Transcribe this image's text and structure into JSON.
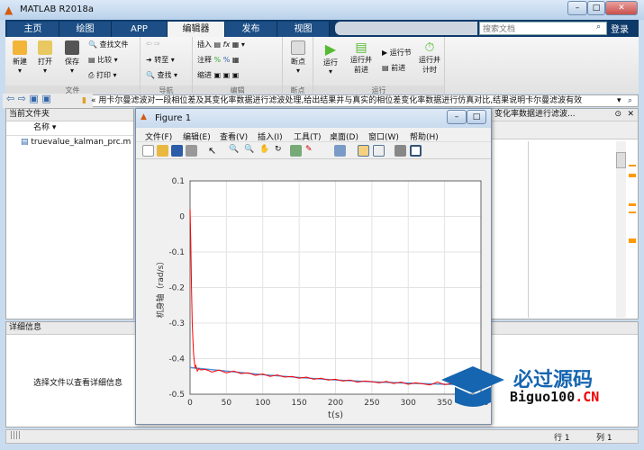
{
  "window": {
    "title": "MATLAB R2018a"
  },
  "tabs": [
    {
      "label": "主页"
    },
    {
      "label": "绘图"
    },
    {
      "label": "APP"
    },
    {
      "label": "编辑器"
    },
    {
      "label": "发布"
    },
    {
      "label": "视图"
    }
  ],
  "search": {
    "placeholder": "搜索文档"
  },
  "login": "登录",
  "ribbon": {
    "file": {
      "label": "文件",
      "new": "新建",
      "open": "打开",
      "save": "保存",
      "find_files": "查找文件",
      "compare": "比较",
      "print": "打印"
    },
    "nav": {
      "label": "导航",
      "goto": "转至",
      "find": "查找"
    },
    "edit": {
      "label": "编辑",
      "insert": "插入",
      "comment": "注释",
      "indent": "缩进",
      "fx": "fx"
    },
    "breakpoints": {
      "label": "断点",
      "bp": "断点"
    },
    "run": {
      "label": "运行",
      "run": "运行",
      "run_advance": "运行并\n前进",
      "run_section": "运行节",
      "advance": "前进",
      "run_time": "运行并\n计时"
    }
  },
  "address": "« 用卡尔曼滤波对一段相位差及其变化率数据进行滤波处理,给出结果并与真实的相位差变化率数据进行仿真对比,结果说明卡尔曼滤波有效",
  "current_folder": {
    "title": "当前文件夹",
    "column": "名称 ▾",
    "files": [
      "truevalue_kalman_prc.m"
    ]
  },
  "details": {
    "title": "详细信息",
    "empty": "选择文件以查看详细信息"
  },
  "editor_tab": "变化率数据进行滤波...",
  "status": {
    "row_label": "行",
    "row": "1",
    "col_label": "列",
    "col": "1"
  },
  "figure": {
    "title": "Figure 1",
    "menu": [
      "文件(F)",
      "编辑(E)",
      "查看(V)",
      "插入(I)",
      "工具(T)",
      "桌面(D)",
      "窗口(W)",
      "帮助(H)"
    ]
  },
  "watermark": {
    "text1": "必过源码",
    "text2": "Biguo100",
    "text3": ".CN"
  },
  "chart_data": {
    "type": "line",
    "xlabel": "t(s)",
    "ylabel": "机身轴（rad/s）",
    "xlim": [
      0,
      400
    ],
    "ylim": [
      -0.5,
      0.1
    ],
    "xticks": [
      0,
      50,
      100,
      150,
      200,
      250,
      300,
      350,
      400
    ],
    "yticks": [
      0.1,
      0,
      -0.1,
      -0.2,
      -0.3,
      -0.4,
      -0.5
    ],
    "grid": true,
    "series": [
      {
        "color": "#4a90d9",
        "x": [
          0,
          50,
          100,
          150,
          200,
          250,
          300,
          350,
          390
        ],
        "y": [
          -0.425,
          -0.435,
          -0.445,
          -0.453,
          -0.46,
          -0.465,
          -0.469,
          -0.472,
          -0.474
        ]
      },
      {
        "color": "#ff0000",
        "x": [
          0,
          1,
          2,
          3,
          4,
          5,
          6,
          7,
          8,
          10,
          12,
          15,
          20,
          25,
          30,
          40,
          50,
          60,
          70,
          80,
          90,
          100,
          110,
          120,
          130,
          140,
          150,
          160,
          170,
          180,
          190,
          200,
          210,
          220,
          230,
          240,
          250,
          260,
          270,
          280,
          290,
          300,
          310,
          320,
          330,
          340,
          350,
          360,
          370,
          380,
          390
        ],
        "y": [
          0.02,
          -0.07,
          -0.2,
          -0.3,
          -0.35,
          -0.39,
          -0.41,
          -0.425,
          -0.42,
          -0.435,
          -0.428,
          -0.432,
          -0.43,
          -0.433,
          -0.438,
          -0.432,
          -0.44,
          -0.435,
          -0.442,
          -0.44,
          -0.447,
          -0.443,
          -0.45,
          -0.446,
          -0.452,
          -0.45,
          -0.455,
          -0.452,
          -0.458,
          -0.455,
          -0.46,
          -0.458,
          -0.463,
          -0.46,
          -0.466,
          -0.463,
          -0.465,
          -0.468,
          -0.464,
          -0.47,
          -0.466,
          -0.472,
          -0.468,
          -0.471,
          -0.474,
          -0.466,
          -0.473,
          -0.47,
          -0.475,
          -0.472,
          -0.474
        ]
      }
    ]
  }
}
